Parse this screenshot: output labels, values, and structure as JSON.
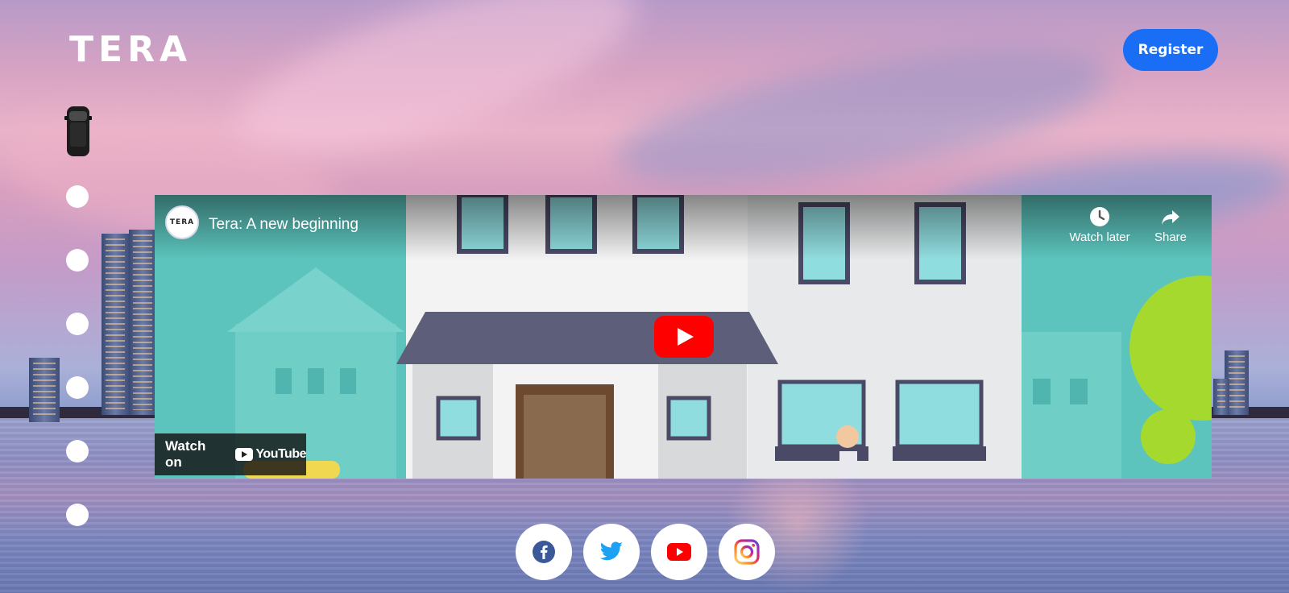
{
  "brand": {
    "logo_text": "TERA"
  },
  "header": {
    "register_label": "Register"
  },
  "video": {
    "title": "Tera: A new beginning",
    "channel_avatar_text": "TERA",
    "watch_later_label": "Watch later",
    "share_label": "Share",
    "watch_on_label": "Watch on",
    "youtube_label": "YouTube"
  },
  "side_nav": {
    "dot_count": 6
  },
  "social": [
    {
      "name": "facebook-icon",
      "color": "#3b5998"
    },
    {
      "name": "twitter-icon",
      "color": "#1da1f2"
    },
    {
      "name": "youtube-icon",
      "color": "#ff0000"
    },
    {
      "name": "instagram-icon",
      "color": "#e1306c"
    }
  ],
  "colors": {
    "accent": "#1a6ef5"
  }
}
